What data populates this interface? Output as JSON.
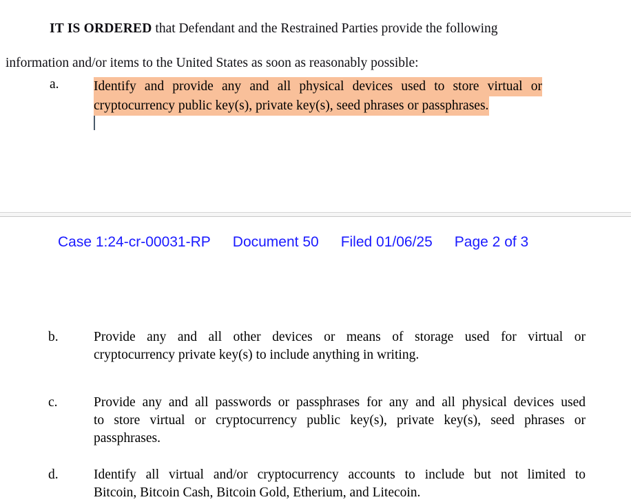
{
  "document": {
    "type": "court-order",
    "background_color": "#ffffff",
    "text_color": "#100f14",
    "highlight_color": "#f9c09a",
    "header_color": "#1a1aff"
  },
  "paragraphs": {
    "ordered_bold": "IT IS ORDERED",
    "ordered_rest": " that Defendant and the Restrained Parties provide the following",
    "ordered_full": "IT IS ORDERED that Defendant and the Restrained Parties provide the following",
    "information_line": "information and/or items to the United States as soon as reasonably possible:"
  },
  "items": [
    {
      "marker": "a.",
      "highlighted": true,
      "lines": [
        "Identify and provide any and all physical devices used to store virtual or",
        "cryptocurrency public key(s), private key(s), seed phrases or passphrases."
      ],
      "text": "Identify and provide any and all physical devices used to store virtual or cryptocurrency public key(s), private key(s), seed phrases or passphrases.",
      "has_caret": true
    },
    {
      "marker": "b.",
      "highlighted": false,
      "lines": [
        "Provide any and all other devices or means of storage used for virtual or",
        "cryptocurrency private key(s) to include anything in writing."
      ],
      "text": "Provide any and all other devices or means of storage used for virtual or cryptocurrency private key(s) to include anything in writing."
    },
    {
      "marker": "c.",
      "highlighted": false,
      "lines": [
        "Provide any and all passwords or passphrases for any and all physical devices used",
        "to store virtual or cryptocurrency public key(s), private key(s), seed phrases or",
        "passphrases."
      ],
      "text": "Provide any and all passwords or passphrases for any and all physical devices used to store virtual or cryptocurrency public key(s), private key(s), seed phrases or passphrases."
    },
    {
      "marker": "d.",
      "highlighted": false,
      "lines": [
        "Identify all virtual and/or cryptocurrency accounts to include but not limited to",
        "Bitcoin, Bitcoin Cash, Bitcoin Gold, Etherium, and Litecoin."
      ],
      "text": "Identify all virtual and/or cryptocurrency accounts to include but not limited to Bitcoin, Bitcoin Cash, Bitcoin Gold, Etherium, and Litecoin."
    }
  ],
  "ecf_header": {
    "case_number": "Case 1:24-cr-00031-RP",
    "document_number": "Document 50",
    "filed_date": "Filed 01/06/25",
    "page_label": "Page 2 of 3"
  }
}
